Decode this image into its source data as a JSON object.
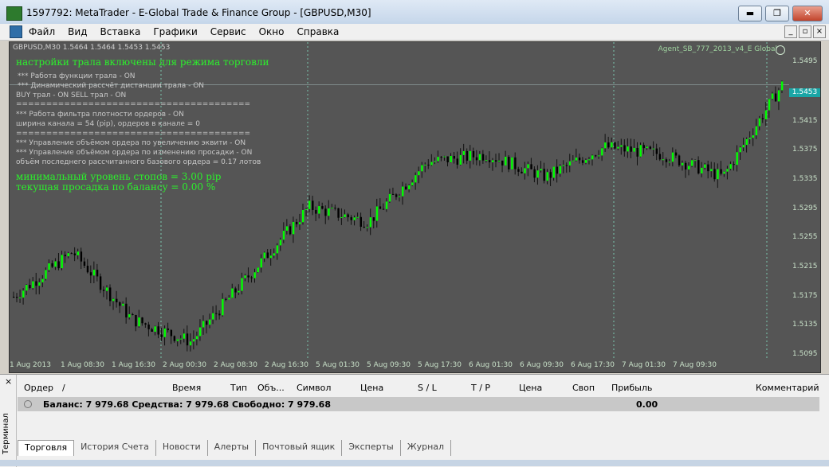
{
  "window": {
    "title": "1597792: MetaTrader - E-Global Trade & Finance Group - [GBPUSD,M30]",
    "buttons": [
      "▬",
      "❐",
      "✕"
    ]
  },
  "menu": {
    "items": [
      "Файл",
      "Вид",
      "Вставка",
      "Графики",
      "Сервис",
      "Окно",
      "Справка"
    ],
    "mdi_buttons": [
      "_",
      "▫",
      "×"
    ]
  },
  "chart": {
    "header": "GBPUSD,M30  1.5464 1.5464 1.5453 1.5453",
    "expert": "Agent_SB_777_2013_v4_E Global",
    "info_lines": [
      "настройки трала включены для режима  торговли",
      "*** Работа функции трала -   ON",
      "*** Динамический рассчёт дистанции трала -   ON",
      "BUY трал -   ON   SELL трал -   ON",
      "=======================================",
      "*** Работа фильтра плотности ордеров -   ON",
      "ширина канала = 54 (pip), ордеров в канале =  0",
      "=======================================",
      "*** Управление объёмом ордера по увеличению эквити -   ON",
      "*** Управление объёмом ордера по изменению просадки -   ON",
      "объём последнего рассчитанного базового ордера =  0.17 лотов",
      "минимальный уровень стопов = 3.00 pip",
      "текущая просадка по балансу = 0.00 %"
    ],
    "price_ticks": [
      "1.5495",
      "1.5415",
      "1.5375",
      "1.5335",
      "1.5295",
      "1.5255",
      "1.5215",
      "1.5175",
      "1.5135",
      "1.5095"
    ],
    "current_price": "1.5453",
    "time_ticks": [
      "1 Aug 2013",
      "1 Aug 08:30",
      "1 Aug 16:30",
      "2 Aug 00:30",
      "2 Aug 08:30",
      "2 Aug 16:30",
      "5 Aug 01:30",
      "5 Aug 09:30",
      "5 Aug 17:30",
      "6 Aug 01:30",
      "6 Aug 09:30",
      "6 Aug 17:30",
      "7 Aug 01:30",
      "7 Aug 09:30"
    ],
    "colors": {
      "background": "#555555",
      "up": "#00ff00",
      "down": "#ff3030",
      "info": "#2cf02c"
    }
  },
  "chart_data": {
    "type": "line",
    "title": "GBPUSD,M30",
    "x": [
      "1 Aug 2013",
      "1 Aug 08:30",
      "1 Aug 16:30",
      "2 Aug 00:30",
      "2 Aug 08:30",
      "2 Aug 16:30",
      "5 Aug 01:30",
      "5 Aug 09:30",
      "5 Aug 17:30",
      "6 Aug 01:30",
      "6 Aug 09:30",
      "6 Aug 17:30",
      "7 Aug 01:30",
      "7 Aug 09:30"
    ],
    "series": [
      {
        "name": "GBPUSD",
        "values": [
          1.517,
          1.523,
          1.514,
          1.511,
          1.52,
          1.529,
          1.527,
          1.535,
          1.536,
          1.533,
          1.537,
          1.536,
          1.533,
          1.5453
        ]
      }
    ],
    "ylim": [
      1.5085,
      1.551
    ]
  },
  "terminal": {
    "side_label": "Терминал",
    "close_label": "×",
    "columns": [
      "Ордер",
      "/",
      "Время",
      "Тип",
      "Объ...",
      "Символ",
      "Цена",
      "S / L",
      "T / P",
      "Цена",
      "Своп",
      "Прибыль",
      "Комментарий"
    ],
    "balance_row": "Баланс: 7 979.68  Средства: 7 979.68  Свободно: 7 979.68",
    "profit": "0.00",
    "tabs": [
      "Торговля",
      "История Счета",
      "Новости",
      "Алерты",
      "Почтовый ящик",
      "Эксперты",
      "Журнал"
    ]
  }
}
